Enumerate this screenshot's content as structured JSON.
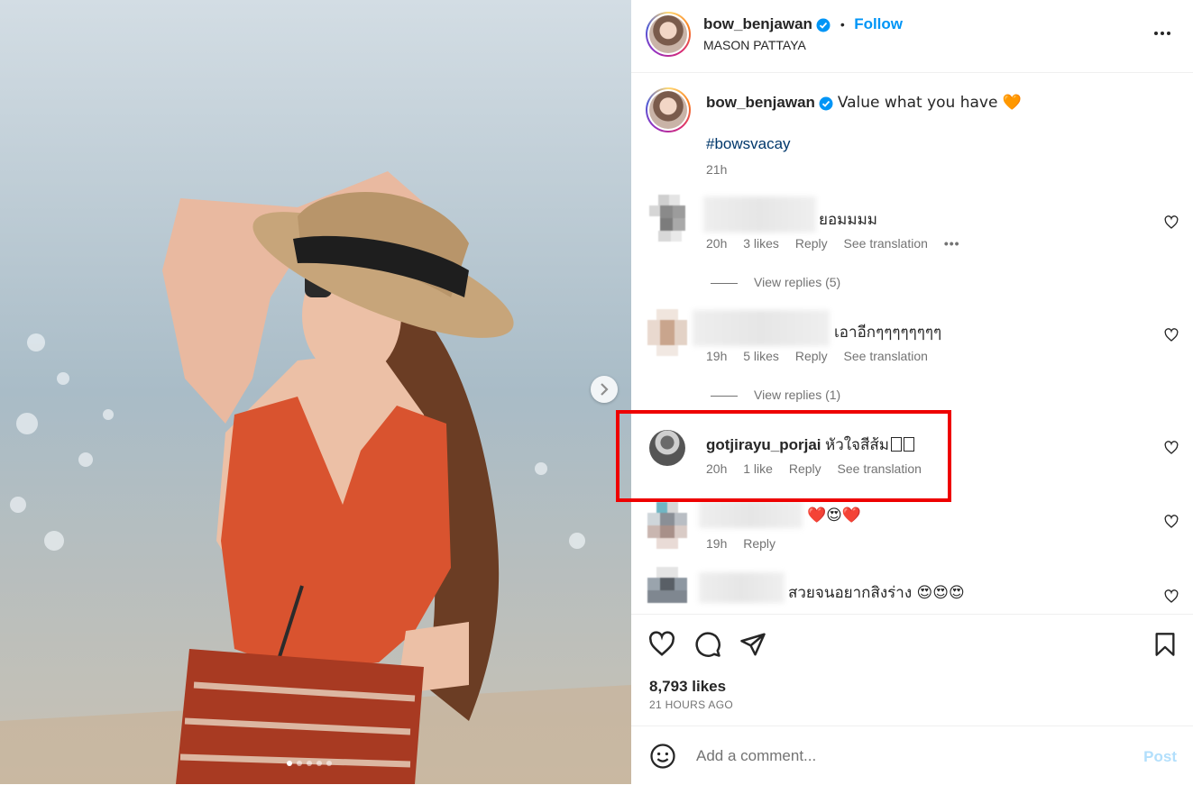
{
  "post": {
    "author": "bow_benjawan",
    "follow_label": "Follow",
    "separator": "•",
    "location": "MASON PATTAYA",
    "caption": "Value what you have 🧡",
    "hashtag": "#bowsvacay",
    "caption_time": "21h"
  },
  "comments": [
    {
      "username": "",
      "text": "ยอมมมม",
      "time": "20h",
      "likes": "3 likes",
      "reply": "Reply",
      "translate": "See translation",
      "more": "•••",
      "view_replies": "View replies (5)"
    },
    {
      "username": "",
      "text": "เอาอีกๆๆๆๆๆๆๆๆ",
      "time": "19h",
      "likes": "5 likes",
      "reply": "Reply",
      "translate": "See translation",
      "view_replies": "View replies (1)"
    },
    {
      "username": "gotjirayu_porjai",
      "text": "หัวใจสีส้ม",
      "time": "20h",
      "likes": "1 like",
      "reply": "Reply",
      "translate": "See translation"
    },
    {
      "username": "",
      "text": "❤️😍❤️",
      "time": "19h",
      "reply": "Reply"
    },
    {
      "username": "",
      "text": "สวยจนอยากสิงร่าง 😍😍😍"
    }
  ],
  "footer": {
    "likes": "8,793 likes",
    "time_ago": "21 HOURS AGO",
    "comment_placeholder": "Add a comment...",
    "post_label": "Post"
  },
  "carousel": {
    "total": 5,
    "active": 0
  },
  "colors": {
    "accent": "#0095f6",
    "highlight": "#e00000",
    "swimsuit": "#d9532f"
  }
}
